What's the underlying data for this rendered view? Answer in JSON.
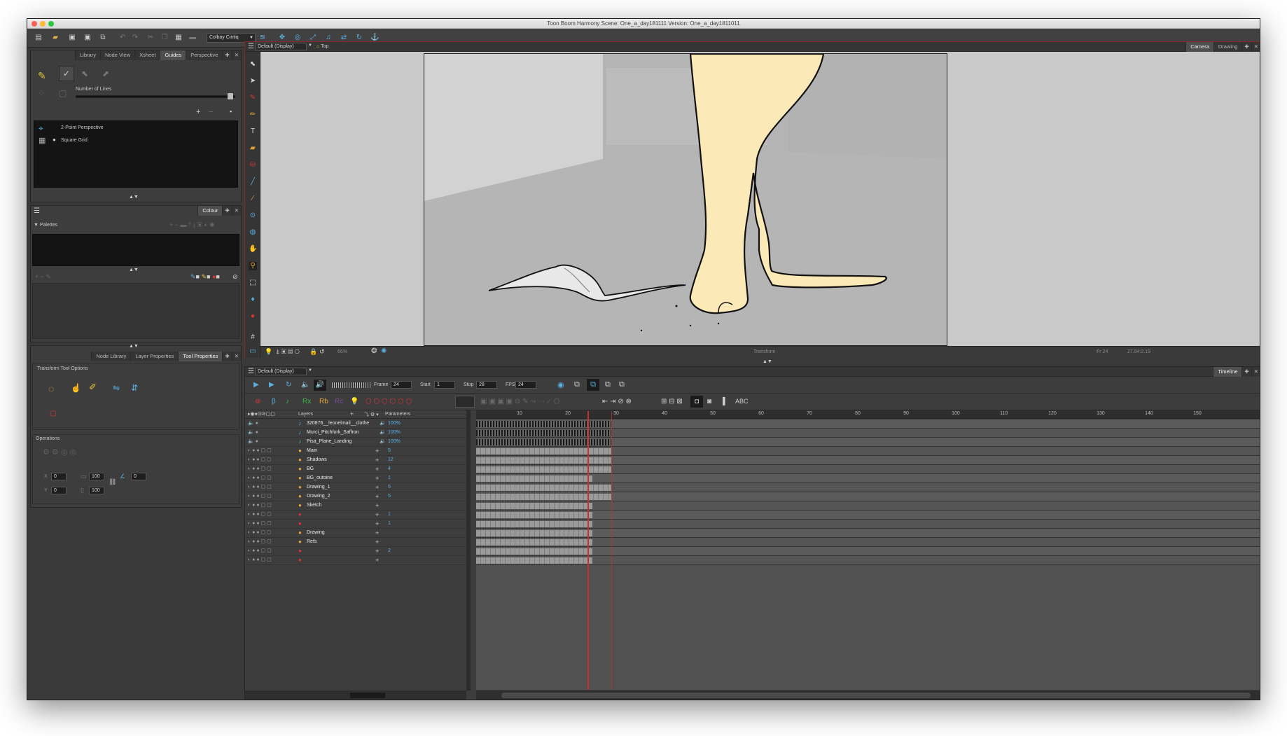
{
  "window": {
    "title": "Toon Boom Harmony Scene: One_a_day181111 Version: One_a_day1811011",
    "accent": "#c93030",
    "traffic_colors": [
      "#ff5f57",
      "#febc2e",
      "#28c840"
    ]
  },
  "toolbar": {
    "device_select": "Colbay Cintiq"
  },
  "guides_panel": {
    "tabs": [
      "Library",
      "Node View",
      "Xsheet",
      "Guides",
      "Perspective"
    ],
    "active_tab": "Guides",
    "number_of_lines_label": "Number of Lines",
    "guides": [
      {
        "name": "2-Point Perspective"
      },
      {
        "name": "Square Grid"
      }
    ]
  },
  "colour_panel": {
    "tab": "Colour",
    "palettes_label": "Palettes"
  },
  "tool_panel": {
    "tabs": [
      "Node Library",
      "Layer Properties",
      "Tool Properties"
    ],
    "active_tab": "Tool Properties",
    "section_label": "Transform Tool Options",
    "operations_label": "Operations",
    "fields": {
      "x": "0",
      "y": "0",
      "w": "100",
      "h": "100",
      "angle": "0"
    },
    "axis_labels": {
      "x": "X",
      "y": "Y"
    }
  },
  "camera_view": {
    "view_select": "Default (Display)",
    "breadcrumb": "Top",
    "tabs": [
      "Camera",
      "Drawing"
    ],
    "active_tab": "Camera",
    "zoom": "66%",
    "status_tool": "Transform",
    "frame_status": "Fr 24",
    "coords": "27.94:2.19"
  },
  "timeline": {
    "view_select": "Default (Display)",
    "tab": "Timeline",
    "frame_label": "Frame",
    "frame_value": "24",
    "start_label": "Start",
    "start_value": "1",
    "stop_label": "Stop",
    "stop_value": "28",
    "fps_label": "FPS",
    "fps_value": "24",
    "layers_header": "Layers",
    "parameters_header": "Parameters",
    "ruler_ticks": [
      "10",
      "20",
      "30",
      "40",
      "50",
      "60",
      "70",
      "80",
      "90",
      "100",
      "110",
      "120",
      "130",
      "140",
      "150"
    ],
    "current_frame": 24,
    "stop_frame": 28,
    "layers": [
      {
        "name": "320876__leonelmail__clothe",
        "param": "100%",
        "type": "sound",
        "cells": 28
      },
      {
        "name": "Murci_Pitchfork_Saffron",
        "param": "100%",
        "type": "sound",
        "cells": 28
      },
      {
        "name": "Pisa_Plane_Landing",
        "param": "100%",
        "type": "sound",
        "cells": 28
      },
      {
        "name": "Main",
        "param": "5",
        "type": "drawing",
        "cells": 28
      },
      {
        "name": "Shadows",
        "param": "12",
        "type": "drawing",
        "cells": 28
      },
      {
        "name": "BG",
        "param": "4",
        "type": "drawing",
        "cells": 28
      },
      {
        "name": "BG_outoine",
        "param": "1",
        "type": "drawing",
        "cells": 24
      },
      {
        "name": "Drawing_1",
        "param": "5",
        "type": "drawing",
        "cells": 28
      },
      {
        "name": "Drawing_2",
        "param": "5",
        "type": "drawing",
        "cells": 28
      },
      {
        "name": "Sketch",
        "param": "",
        "type": "drawing",
        "cells": 24
      },
      {
        "name": "",
        "param": "1",
        "type": "red",
        "cells": 24
      },
      {
        "name": "",
        "param": "1",
        "type": "red",
        "cells": 24
      },
      {
        "name": "Drawing",
        "param": "",
        "type": "drawing",
        "cells": 24
      },
      {
        "name": "Refs",
        "param": "",
        "type": "drawing",
        "cells": 24
      },
      {
        "name": "",
        "param": "2",
        "type": "red",
        "cells": 24
      },
      {
        "name": "",
        "param": "",
        "type": "red",
        "cells": 24
      }
    ]
  }
}
